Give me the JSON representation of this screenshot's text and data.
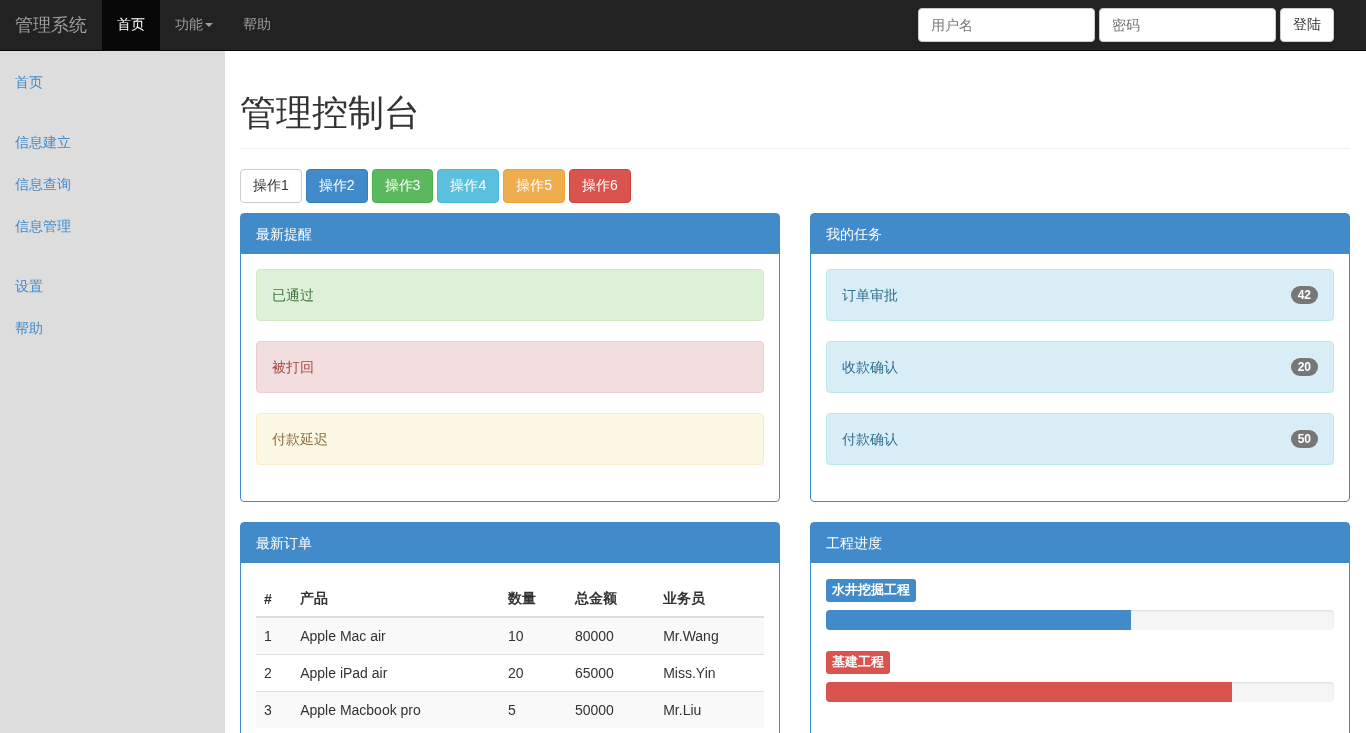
{
  "navbar": {
    "brand": "管理系统",
    "items": [
      {
        "label": "首页",
        "selected": true,
        "dropdown": false
      },
      {
        "label": "功能",
        "selected": false,
        "dropdown": true
      },
      {
        "label": "帮助",
        "selected": false,
        "dropdown": false
      }
    ],
    "login": {
      "username_placeholder": "用户名",
      "password_placeholder": "密码",
      "button": "登陆"
    }
  },
  "sidebar": {
    "groups": [
      [
        {
          "label": "首页"
        }
      ],
      [
        {
          "label": "信息建立"
        },
        {
          "label": "信息查询"
        },
        {
          "label": "信息管理"
        }
      ],
      [
        {
          "label": "设置"
        },
        {
          "label": "帮助"
        }
      ]
    ]
  },
  "page_title": "管理控制台",
  "actions": [
    {
      "label": "操作1",
      "kind": "default"
    },
    {
      "label": "操作2",
      "kind": "primary"
    },
    {
      "label": "操作3",
      "kind": "success"
    },
    {
      "label": "操作4",
      "kind": "info"
    },
    {
      "label": "操作5",
      "kind": "warning"
    },
    {
      "label": "操作6",
      "kind": "danger"
    }
  ],
  "notices": {
    "title": "最新提醒",
    "items": [
      {
        "text": "已通过",
        "kind": "success"
      },
      {
        "text": "被打回",
        "kind": "danger"
      },
      {
        "text": "付款延迟",
        "kind": "warning"
      }
    ]
  },
  "tasks": {
    "title": "我的任务",
    "items": [
      {
        "text": "订单审批",
        "count": "42"
      },
      {
        "text": "收款确认",
        "count": "20"
      },
      {
        "text": "付款确认",
        "count": "50"
      }
    ]
  },
  "orders": {
    "title": "最新订单",
    "columns": [
      "#",
      "产品",
      "数量",
      "总金额",
      "业务员"
    ],
    "rows": [
      [
        "1",
        "Apple Mac air",
        "10",
        "80000",
        "Mr.Wang"
      ],
      [
        "2",
        "Apple iPad air",
        "20",
        "65000",
        "Miss.Yin"
      ],
      [
        "3",
        "Apple Macbook pro",
        "5",
        "50000",
        "Mr.Liu"
      ]
    ]
  },
  "progress": {
    "title": "工程进度",
    "items": [
      {
        "label": "水井挖掘工程",
        "kind": "primary",
        "level": 0.6
      },
      {
        "label": "基建工程",
        "kind": "danger",
        "level": 0.8
      }
    ]
  }
}
